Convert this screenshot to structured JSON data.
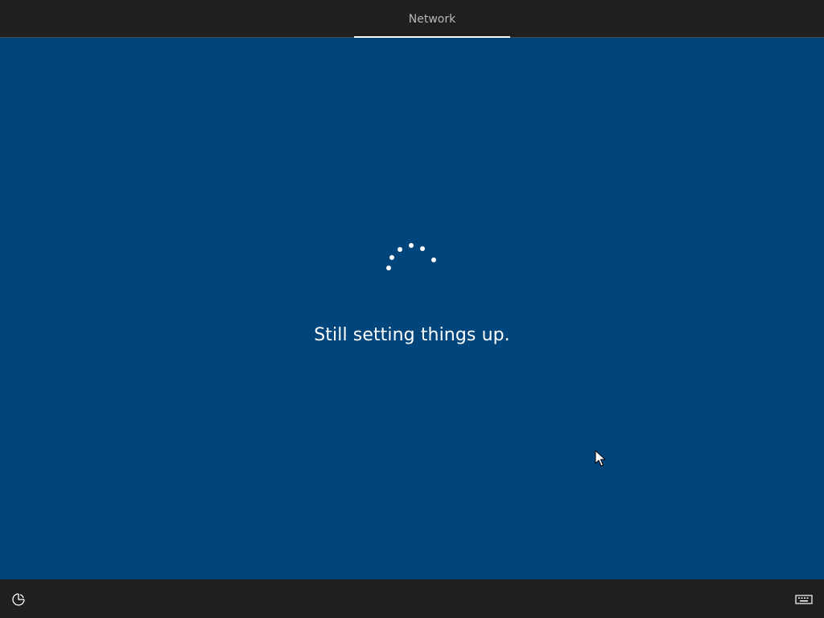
{
  "header": {
    "tabs": [
      {
        "label": "Network",
        "active": true
      }
    ]
  },
  "main": {
    "status_text": "Still setting things up.",
    "spinner_icon": "loading-dots-icon"
  },
  "footer": {
    "left_icon": "ease-of-access-icon",
    "right_icon": "keyboard-icon"
  },
  "colors": {
    "background": "#00457c",
    "bar": "#1f1f1f",
    "text": "#ffffff",
    "tab_text": "#b9b9b9"
  }
}
